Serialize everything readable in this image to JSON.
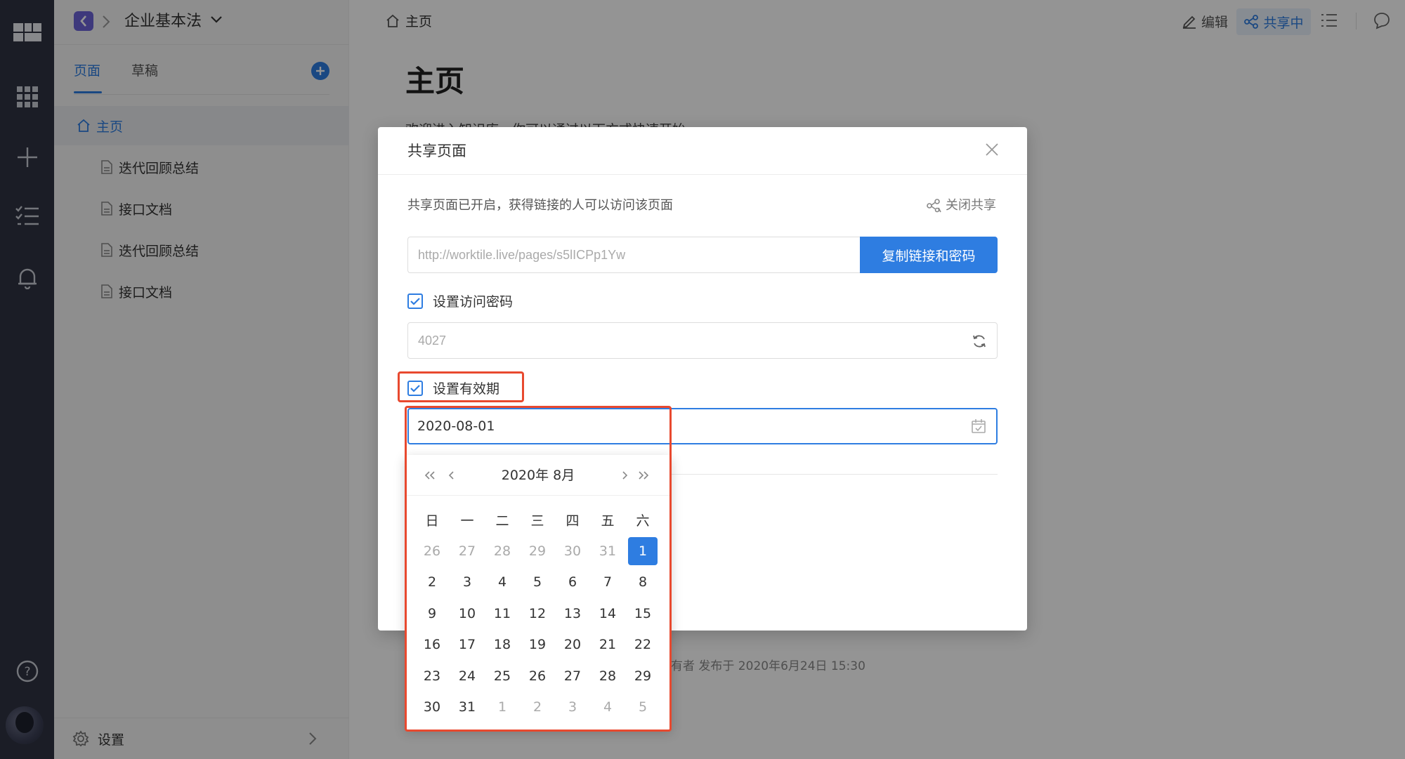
{
  "workspace": {
    "name": "企业基本法"
  },
  "sidebar": {
    "tabs": {
      "pages": "页面",
      "drafts": "草稿"
    },
    "tree": [
      {
        "label": "主页",
        "active": true
      },
      {
        "label": "迭代回顾总结"
      },
      {
        "label": "接口文档"
      },
      {
        "label": "迭代回顾总结"
      },
      {
        "label": "接口文档"
      }
    ],
    "footer_label": "设置"
  },
  "main": {
    "breadcrumb": "主页",
    "actions": {
      "edit": "编辑",
      "share": "共享中"
    },
    "page_title": "主页",
    "intro_text": "欢迎进入知识库，你可以通过以下方式快速开始",
    "meta_text": "有者 发布于 2020年6月24日 15:30"
  },
  "dialog": {
    "title": "共享页面",
    "status_text": "共享页面已开启，获得链接的人可以访问该页面",
    "stop_share": "关闭共享",
    "link_value": "http://worktile.live/pages/s5lICPp1Yw",
    "copy_button": "复制链接和密码",
    "password_label": "设置访问密码",
    "password_value": "4027",
    "expiry_label": "设置有效期",
    "expiry_value": "2020-08-01"
  },
  "picker": {
    "title": "2020年 8月",
    "weekdays": [
      "日",
      "一",
      "二",
      "三",
      "四",
      "五",
      "六"
    ],
    "days": [
      [
        {
          "d": "26",
          "m": 1
        },
        {
          "d": "27",
          "m": 1
        },
        {
          "d": "28",
          "m": 1
        },
        {
          "d": "29",
          "m": 1
        },
        {
          "d": "30",
          "m": 1
        },
        {
          "d": "31",
          "m": 1
        },
        {
          "d": "1",
          "sel": 1
        }
      ],
      [
        {
          "d": "2"
        },
        {
          "d": "3"
        },
        {
          "d": "4"
        },
        {
          "d": "5"
        },
        {
          "d": "6"
        },
        {
          "d": "7"
        },
        {
          "d": "8"
        }
      ],
      [
        {
          "d": "9"
        },
        {
          "d": "10"
        },
        {
          "d": "11"
        },
        {
          "d": "12"
        },
        {
          "d": "13"
        },
        {
          "d": "14"
        },
        {
          "d": "15"
        }
      ],
      [
        {
          "d": "16"
        },
        {
          "d": "17"
        },
        {
          "d": "18"
        },
        {
          "d": "19"
        },
        {
          "d": "20"
        },
        {
          "d": "21"
        },
        {
          "d": "22"
        }
      ],
      [
        {
          "d": "23"
        },
        {
          "d": "24"
        },
        {
          "d": "25"
        },
        {
          "d": "26"
        },
        {
          "d": "27"
        },
        {
          "d": "28"
        },
        {
          "d": "29"
        }
      ],
      [
        {
          "d": "30"
        },
        {
          "d": "31"
        },
        {
          "d": "1",
          "m": 1
        },
        {
          "d": "2",
          "m": 1
        },
        {
          "d": "3",
          "m": 1
        },
        {
          "d": "4",
          "m": 1
        },
        {
          "d": "5",
          "m": 1
        }
      ]
    ]
  },
  "colors": {
    "accent": "#2e7de1",
    "highlight": "#e8492f",
    "rail": "#2f3342"
  }
}
